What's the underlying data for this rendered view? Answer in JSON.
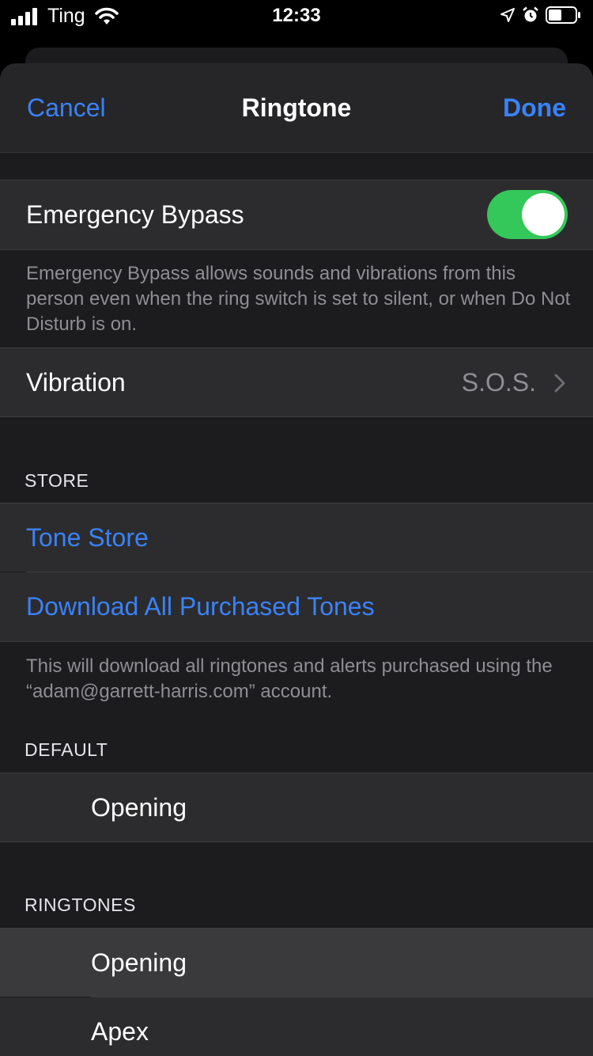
{
  "status_bar": {
    "carrier": "Ting",
    "time": "12:33"
  },
  "nav": {
    "cancel_label": "Cancel",
    "title": "Ringtone",
    "done_label": "Done"
  },
  "emergency": {
    "label": "Emergency Bypass",
    "enabled": true,
    "footer": "Emergency Bypass allows sounds and vibrations from this person even when the ring switch is set to silent, or when Do Not Disturb is on."
  },
  "vibration": {
    "label": "Vibration",
    "value": "S.O.S."
  },
  "store": {
    "header": "STORE",
    "items": [
      "Tone Store",
      "Download All Purchased Tones"
    ],
    "footer": "This will download all ringtones and alerts purchased using the “adam@garrett-harris.com” account."
  },
  "default": {
    "header": "DEFAULT",
    "item": "Opening"
  },
  "ringtones": {
    "header": "RINGTONES",
    "items": [
      "Opening",
      "Apex"
    ]
  },
  "colors": {
    "accent": "#3a82f7",
    "toggle_on": "#34c759",
    "background": "#1c1c1e",
    "cell": "#2c2c2e"
  }
}
